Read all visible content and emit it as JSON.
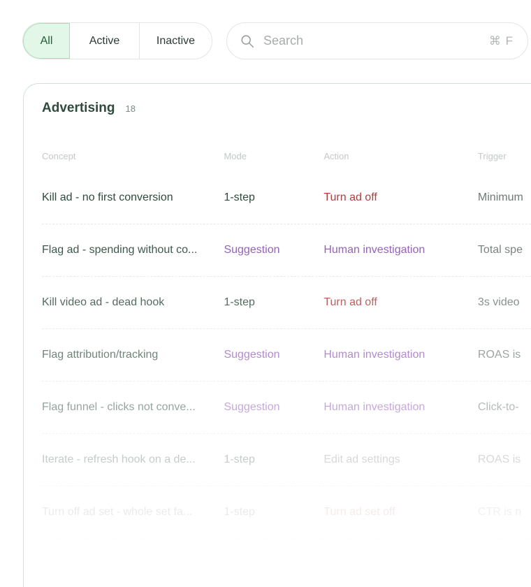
{
  "filters": [
    {
      "label": "All",
      "selected": true
    },
    {
      "label": "Active",
      "selected": false
    },
    {
      "label": "Inactive",
      "selected": false
    }
  ],
  "search": {
    "placeholder": "Search",
    "value": "",
    "shortcut": "⌘ F",
    "icon": "search-icon"
  },
  "card": {
    "title": "Advertising",
    "count": "18"
  },
  "table": {
    "columns": [
      "Concept",
      "Mode",
      "Action",
      "Trigger"
    ],
    "rows": [
      {
        "concept": "Kill ad - no first conversion",
        "mode": "1-step",
        "action": "Turn ad off",
        "trigger": "Minimum"
      },
      {
        "concept": "Flag ad - spending without co...",
        "mode": "Suggestion",
        "action": "Human investigation",
        "trigger": "Total spe"
      },
      {
        "concept": "Kill video ad - dead hook",
        "mode": "1-step",
        "action": "Turn ad off",
        "trigger": "3s video"
      },
      {
        "concept": "Flag attribution/tracking",
        "mode": "Suggestion",
        "action": "Human investigation",
        "trigger": "ROAS is"
      },
      {
        "concept": "Flag funnel - clicks not conve...",
        "mode": "Suggestion",
        "action": "Human investigation",
        "trigger": "Click-to-"
      },
      {
        "concept": "Iterate - refresh hook on a de...",
        "mode": "1-step",
        "action": "Edit ad settings",
        "trigger": "ROAS is"
      },
      {
        "concept": "Turn off ad set - whole set fa...",
        "mode": "1-step",
        "action": "Turn ad set off",
        "trigger": "CTR is n"
      }
    ]
  },
  "colors": {
    "accent_green_bg": "#e3f7e9",
    "accent_green_border": "#a6dfb9",
    "suggestion_purple": "#8d55b2",
    "turn_off_red": "#b23b3b",
    "text_dark_green": "#2f4a3c"
  }
}
